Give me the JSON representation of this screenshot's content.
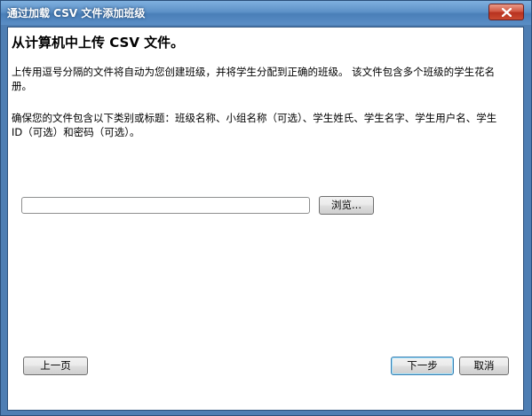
{
  "window": {
    "title": "通过加载 CSV 文件添加班级",
    "close_icon": "close-icon"
  },
  "content": {
    "heading": "从计算机中上传 CSV 文件。",
    "paragraph1": "上传用逗号分隔的文件将自动为您创建班级，并将学生分配到正确的班级。 该文件包含多个班级的学生花名册。",
    "paragraph2": "确保您的文件包含以下类别或标题：班级名称、小组名称（可选）、学生姓氏、学生名字、学生用户名、学生 ID（可选）和密码（可选）。"
  },
  "file_picker": {
    "value": "",
    "browse_label": "浏览..."
  },
  "footer": {
    "prev_label": "上一页",
    "next_label": "下一步",
    "cancel_label": "取消"
  },
  "colors": {
    "title_bar": "#5e92c8",
    "close_button": "#c94a30",
    "default_button_border": "#3c7fb1"
  }
}
